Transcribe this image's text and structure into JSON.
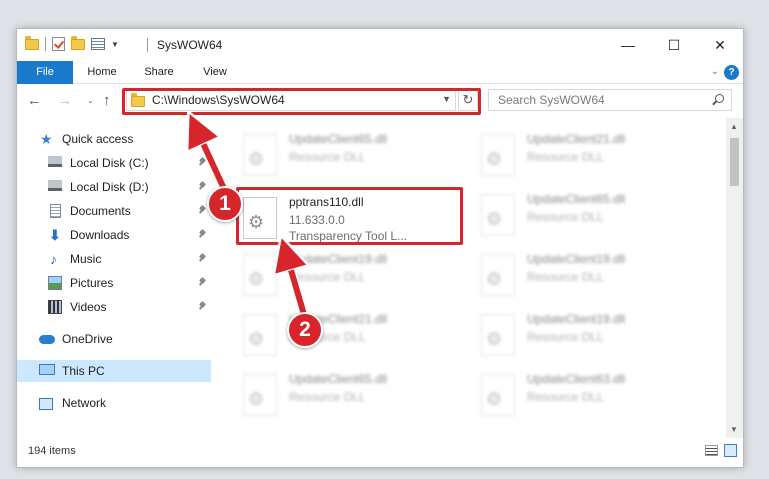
{
  "window": {
    "title": "SysWOW64",
    "controls": {
      "minimize": "—",
      "maximize": "☐",
      "close": "✕"
    }
  },
  "ribbon": {
    "tabs": [
      "File",
      "Home",
      "Share",
      "View"
    ],
    "expand_glyph": "⌄",
    "help_glyph": "?"
  },
  "address": {
    "path": "C:\\Windows\\SysWOW64",
    "refresh_glyph": "↻",
    "search_placeholder": "Search SysWOW64"
  },
  "nav": {
    "back_glyph": "←",
    "forward_glyph": "→",
    "recent_glyph": "⌄",
    "up_glyph": "↑",
    "items": [
      {
        "label": "Quick access",
        "icon": "star-icon",
        "pinned": false
      },
      {
        "label": "Local Disk (C:)",
        "icon": "disk-icon",
        "pinned": true
      },
      {
        "label": "Local Disk (D:)",
        "icon": "disk-icon",
        "pinned": true
      },
      {
        "label": "Documents",
        "icon": "documents-icon",
        "pinned": true
      },
      {
        "label": "Downloads",
        "icon": "downloads-icon",
        "pinned": true
      },
      {
        "label": "Music",
        "icon": "music-icon",
        "pinned": true
      },
      {
        "label": "Pictures",
        "icon": "pictures-icon",
        "pinned": true
      },
      {
        "label": "Videos",
        "icon": "videos-icon",
        "pinned": true
      },
      {
        "label": "OneDrive",
        "icon": "onedrive-icon",
        "pinned": false
      },
      {
        "label": "This PC",
        "icon": "this-pc-icon",
        "pinned": false,
        "selected": true
      },
      {
        "label": "Network",
        "icon": "network-icon",
        "pinned": false
      }
    ]
  },
  "files": {
    "highlighted": {
      "name": "pptrans110.dll",
      "version": "11.633.0.0",
      "description": "Transparency Tool L..."
    },
    "blurred": [
      {
        "name": "UpdateClient65.dll",
        "type": "Resource DLL"
      },
      {
        "name": "UpdateClient21.dll",
        "type": "Resource DLL"
      },
      {
        "name": "UpdateClient65.dll",
        "type": "Resource DLL"
      },
      {
        "name": "UpdateClient19.dll",
        "type": "Resource DLL"
      },
      {
        "name": "UpdateClient19.dll",
        "type": "Resource DLL"
      },
      {
        "name": "UpdateClient21.dll",
        "type": "Resource DLL"
      },
      {
        "name": "UpdateClient19.dll",
        "type": "Resource DLL"
      },
      {
        "name": "UpdateClient65.dll",
        "type": "Resource DLL"
      },
      {
        "name": "UpdateClient63.dll",
        "type": "Resource DLL"
      }
    ]
  },
  "status": {
    "item_count": "194 items"
  },
  "callouts": [
    "1",
    "2"
  ],
  "colors": {
    "accent": "#1979ca",
    "highlight": "#d6262b",
    "selected_bg": "#cce8ff"
  }
}
